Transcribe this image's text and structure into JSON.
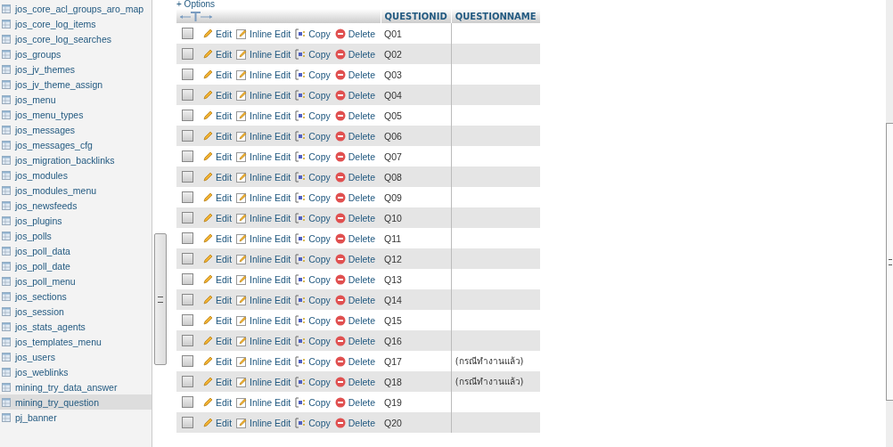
{
  "sidebar": {
    "items": [
      {
        "label": "jos_core_acl_groups_aro_map",
        "selected": false
      },
      {
        "label": "jos_core_log_items",
        "selected": false
      },
      {
        "label": "jos_core_log_searches",
        "selected": false
      },
      {
        "label": "jos_groups",
        "selected": false
      },
      {
        "label": "jos_jv_themes",
        "selected": false
      },
      {
        "label": "jos_jv_theme_assign",
        "selected": false
      },
      {
        "label": "jos_menu",
        "selected": false
      },
      {
        "label": "jos_menu_types",
        "selected": false
      },
      {
        "label": "jos_messages",
        "selected": false
      },
      {
        "label": "jos_messages_cfg",
        "selected": false
      },
      {
        "label": "jos_migration_backlinks",
        "selected": false
      },
      {
        "label": "jos_modules",
        "selected": false
      },
      {
        "label": "jos_modules_menu",
        "selected": false
      },
      {
        "label": "jos_newsfeeds",
        "selected": false
      },
      {
        "label": "jos_plugins",
        "selected": false
      },
      {
        "label": "jos_polls",
        "selected": false
      },
      {
        "label": "jos_poll_data",
        "selected": false
      },
      {
        "label": "jos_poll_date",
        "selected": false
      },
      {
        "label": "jos_poll_menu",
        "selected": false
      },
      {
        "label": "jos_sections",
        "selected": false
      },
      {
        "label": "jos_session",
        "selected": false
      },
      {
        "label": "jos_stats_agents",
        "selected": false
      },
      {
        "label": "jos_templates_menu",
        "selected": false
      },
      {
        "label": "jos_users",
        "selected": false
      },
      {
        "label": "jos_weblinks",
        "selected": false
      },
      {
        "label": "mining_try_data_answer",
        "selected": false
      },
      {
        "label": "mining_try_question",
        "selected": true
      },
      {
        "label": "pj_banner",
        "selected": false
      }
    ]
  },
  "options_link": "+ Options",
  "table": {
    "columns": [
      "QUESTIONID",
      "QUESTIONNAME"
    ],
    "rows": [
      {
        "checked": false,
        "actions": [
          "Edit",
          "Inline Edit",
          "Copy",
          "Delete"
        ],
        "questionid": "Q01",
        "questionname": ""
      },
      {
        "checked": false,
        "actions": [
          "Edit",
          "Inline Edit",
          "Copy",
          "Delete"
        ],
        "questionid": "Q02",
        "questionname": ""
      },
      {
        "checked": false,
        "actions": [
          "Edit",
          "Inline Edit",
          "Copy",
          "Delete"
        ],
        "questionid": "Q03",
        "questionname": ""
      },
      {
        "checked": false,
        "actions": [
          "Edit",
          "Inline Edit",
          "Copy",
          "Delete"
        ],
        "questionid": "Q04",
        "questionname": ""
      },
      {
        "checked": false,
        "actions": [
          "Edit",
          "Inline Edit",
          "Copy",
          "Delete"
        ],
        "questionid": "Q05",
        "questionname": ""
      },
      {
        "checked": false,
        "actions": [
          "Edit",
          "Inline Edit",
          "Copy",
          "Delete"
        ],
        "questionid": "Q06",
        "questionname": ""
      },
      {
        "checked": false,
        "actions": [
          "Edit",
          "Inline Edit",
          "Copy",
          "Delete"
        ],
        "questionid": "Q07",
        "questionname": ""
      },
      {
        "checked": false,
        "actions": [
          "Edit",
          "Inline Edit",
          "Copy",
          "Delete"
        ],
        "questionid": "Q08",
        "questionname": ""
      },
      {
        "checked": false,
        "actions": [
          "Edit",
          "Inline Edit",
          "Copy",
          "Delete"
        ],
        "questionid": "Q09",
        "questionname": ""
      },
      {
        "checked": false,
        "actions": [
          "Edit",
          "Inline Edit",
          "Copy",
          "Delete"
        ],
        "questionid": "Q10",
        "questionname": ""
      },
      {
        "checked": false,
        "actions": [
          "Edit",
          "Inline Edit",
          "Copy",
          "Delete"
        ],
        "questionid": "Q11",
        "questionname": ""
      },
      {
        "checked": false,
        "actions": [
          "Edit",
          "Inline Edit",
          "Copy",
          "Delete"
        ],
        "questionid": "Q12",
        "questionname": ""
      },
      {
        "checked": false,
        "actions": [
          "Edit",
          "Inline Edit",
          "Copy",
          "Delete"
        ],
        "questionid": "Q13",
        "questionname": ""
      },
      {
        "checked": false,
        "actions": [
          "Edit",
          "Inline Edit",
          "Copy",
          "Delete"
        ],
        "questionid": "Q14",
        "questionname": ""
      },
      {
        "checked": false,
        "actions": [
          "Edit",
          "Inline Edit",
          "Copy",
          "Delete"
        ],
        "questionid": "Q15",
        "questionname": ""
      },
      {
        "checked": false,
        "actions": [
          "Edit",
          "Inline Edit",
          "Copy",
          "Delete"
        ],
        "questionid": "Q16",
        "questionname": ""
      },
      {
        "checked": false,
        "actions": [
          "Edit",
          "Inline Edit",
          "Copy",
          "Delete"
        ],
        "questionid": "Q17",
        "questionname": "(กรณีทำงานแล้ว)"
      },
      {
        "checked": false,
        "actions": [
          "Edit",
          "Inline Edit",
          "Copy",
          "Delete"
        ],
        "questionid": "Q18",
        "questionname": "(กรณีทำงานแล้ว)"
      },
      {
        "checked": false,
        "actions": [
          "Edit",
          "Inline Edit",
          "Copy",
          "Delete"
        ],
        "questionid": "Q19",
        "questionname": ""
      },
      {
        "checked": false,
        "actions": [
          "Edit",
          "Inline Edit",
          "Copy",
          "Delete"
        ],
        "questionid": "Q20",
        "questionname": ""
      }
    ]
  }
}
